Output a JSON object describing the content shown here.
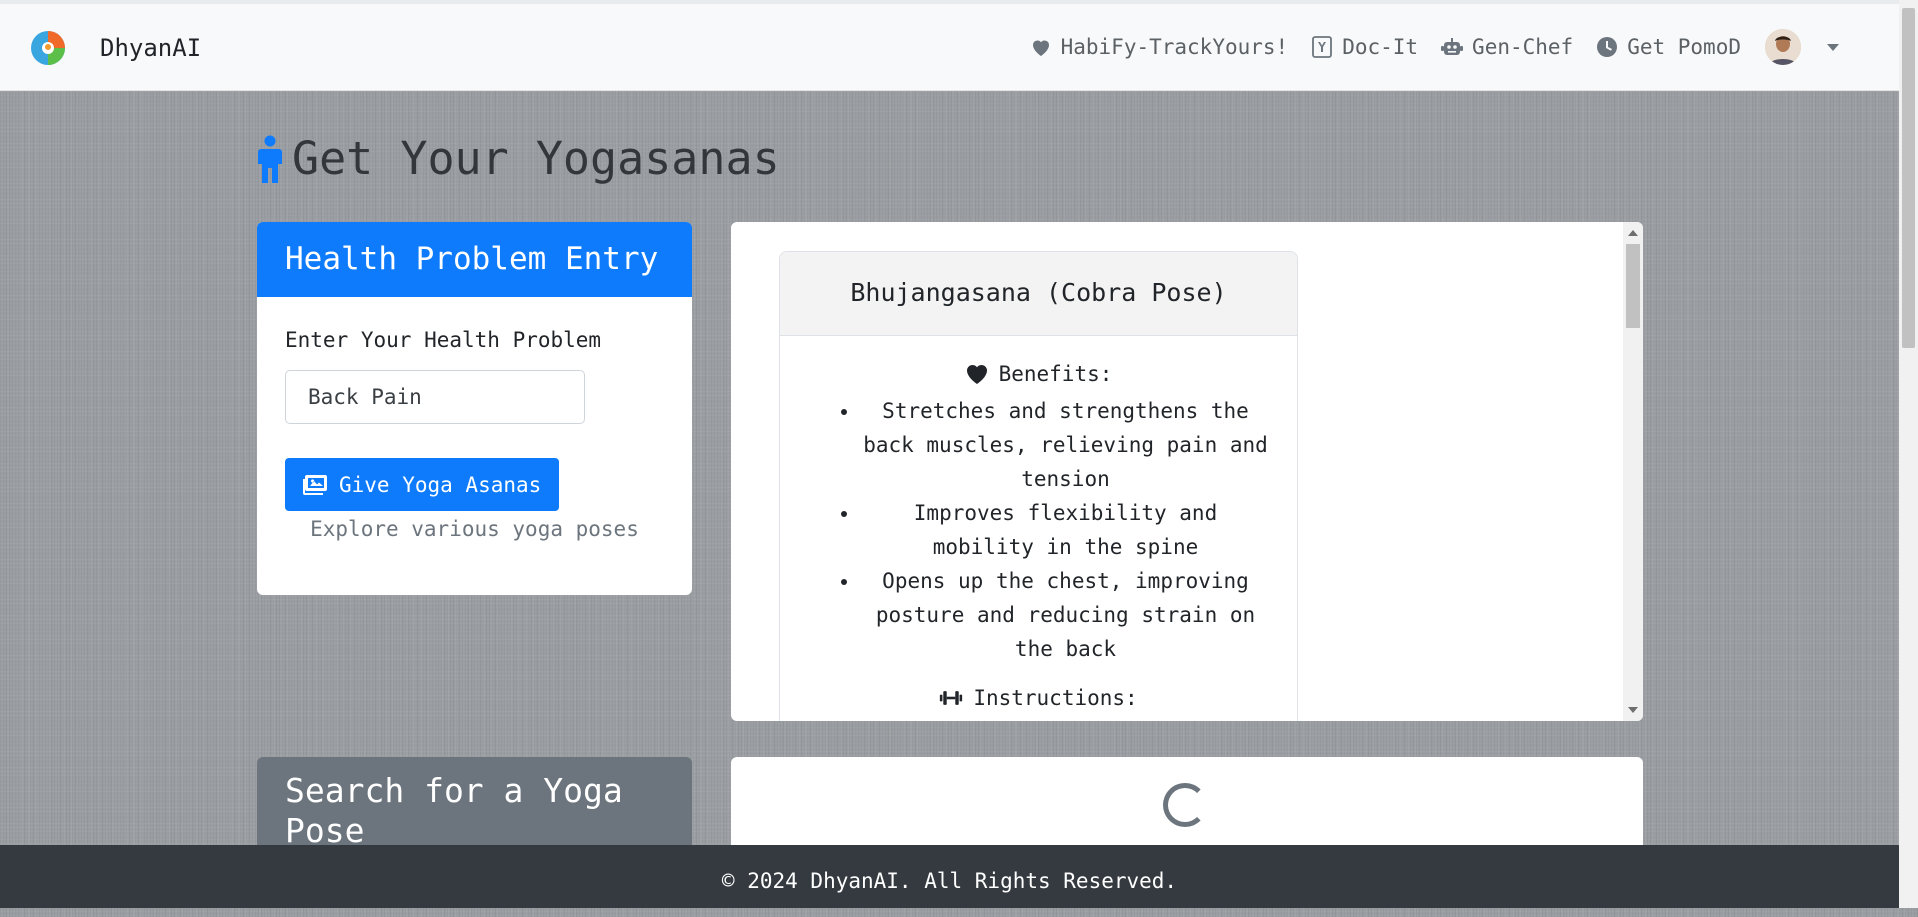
{
  "brand": {
    "name": "DhyanAI"
  },
  "nav": {
    "items": [
      {
        "label": "HabiFy-TrackYours!",
        "icon": "heart-icon"
      },
      {
        "label": "Doc-It",
        "icon": "yahoo-icon"
      },
      {
        "label": "Gen-Chef",
        "icon": "robot-icon"
      },
      {
        "label": "Get PomoD",
        "icon": "clock-icon"
      }
    ]
  },
  "page": {
    "title": "Get Your Yogasanas",
    "title_icon": "person-icon"
  },
  "entry": {
    "header": "Health Problem Entry",
    "label": "Enter Your Health Problem",
    "input_value": "Back Pain",
    "button_label": "Give Yoga Asanas",
    "button_icon": "images-icon",
    "hint": "Explore various yoga poses"
  },
  "pose": {
    "name": "Bhujangasana (Cobra Pose)",
    "benefits_title": "Benefits:",
    "benefits_icon": "heart-icon",
    "benefits": [
      "Stretches and strengthens the back muscles, relieving pain and tension",
      "Improves flexibility and mobility in the spine",
      "Opens up the chest, improving posture and reducing strain on the back"
    ],
    "instructions_title": "Instructions:",
    "instructions_icon": "dumbbell-icon"
  },
  "search": {
    "header": "Search for a Yoga Pose"
  },
  "footer": {
    "text": "© 2024 DhyanAI. All Rights Reserved."
  },
  "colors": {
    "primary": "#0d7bfb",
    "secondary": "#6c757d",
    "footer": "#343a40"
  }
}
